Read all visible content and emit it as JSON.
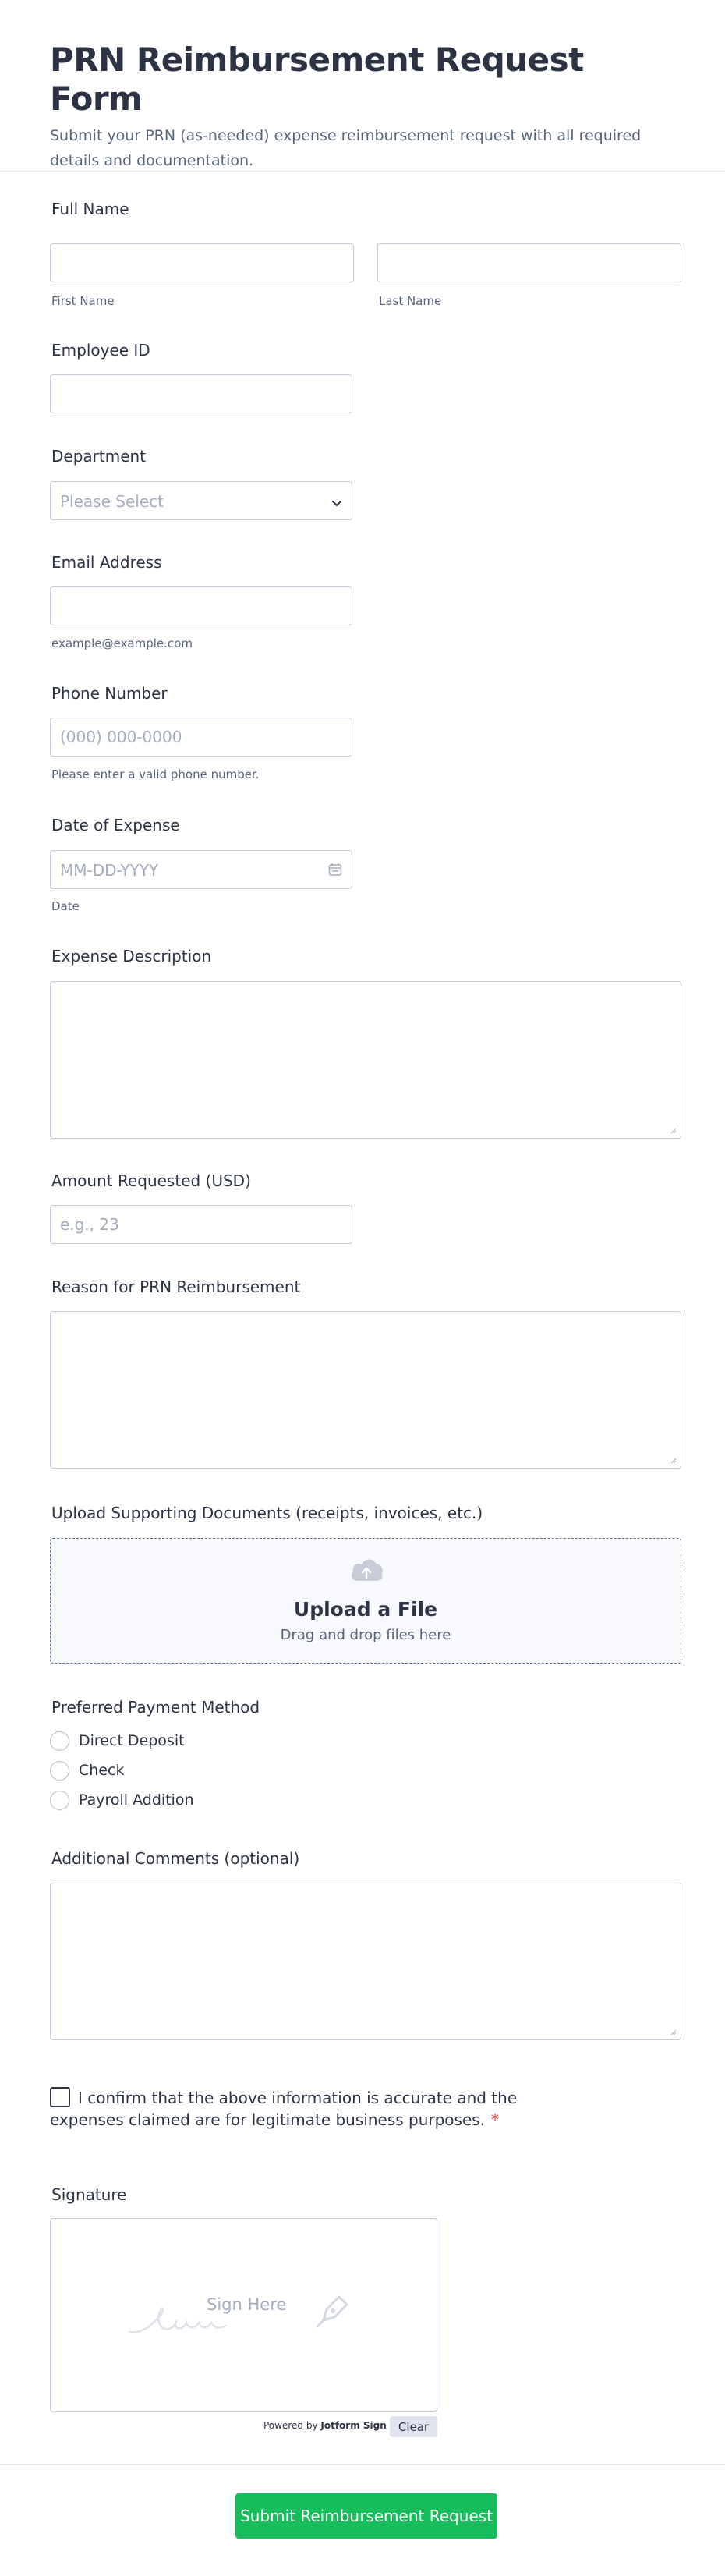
{
  "header": {
    "title": "PRN Reimbursement Request Form",
    "subtitle": "Submit your PRN (as-needed) expense reimbursement request with all required details and documentation."
  },
  "full_name": {
    "label": "Full Name",
    "first_sub": "First Name",
    "last_sub": "Last Name"
  },
  "employee_id": {
    "label": "Employee ID"
  },
  "department": {
    "label": "Department",
    "placeholder": "Please Select"
  },
  "email": {
    "label": "Email Address",
    "sub": "example@example.com"
  },
  "phone": {
    "label": "Phone Number",
    "placeholder": "(000) 000-0000",
    "sub": "Please enter a valid phone number."
  },
  "date": {
    "label": "Date of Expense",
    "placeholder": "MM-DD-YYYY",
    "sub": "Date"
  },
  "description": {
    "label": "Expense Description"
  },
  "amount": {
    "label": "Amount Requested (USD)",
    "placeholder": "e.g., 23"
  },
  "reason": {
    "label": "Reason for PRN Reimbursement"
  },
  "upload": {
    "label": "Upload Supporting Documents (receipts, invoices, etc.)",
    "title": "Upload a File",
    "sub": "Drag and drop files here",
    "icon": "cloud-upload-icon"
  },
  "payment": {
    "label": "Preferred Payment Method",
    "options": [
      "Direct Deposit",
      "Check",
      "Payroll Addition"
    ]
  },
  "comments": {
    "label": "Additional Comments (optional)"
  },
  "consent": {
    "text": "I confirm that the above information is accurate and the expenses claimed are for legitimate business purposes.",
    "required_mark": "*"
  },
  "signature": {
    "label": "Signature",
    "hint": "Sign Here",
    "powered_prefix": "Powered by",
    "powered_brand": "Jotform Sign",
    "clear_label": "Clear"
  },
  "submit": {
    "label": "Submit Reimbursement Request"
  },
  "colors": {
    "accent": "#18bd5b",
    "text": "#2c3345",
    "muted": "#57647e",
    "border": "#c3cad8",
    "required": "#f23a3c"
  }
}
